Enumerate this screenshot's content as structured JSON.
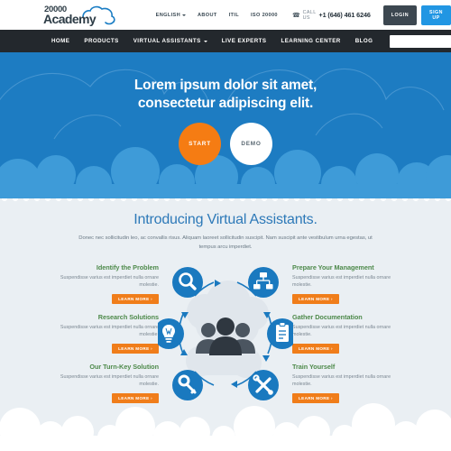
{
  "brand": {
    "logo_top": "20000",
    "logo_bottom": "Academy",
    "cloud_icon": "cloud-icon"
  },
  "topbar": {
    "nav": [
      {
        "label": "ENGLISH",
        "has_caret": true
      },
      {
        "label": "ABOUT",
        "has_caret": false
      },
      {
        "label": "ITIL",
        "has_caret": false
      },
      {
        "label": "ISO 20000",
        "has_caret": false
      }
    ],
    "call_us_label": "CALL US",
    "phone": "+1 (646) 461 6246",
    "login_label": "LOGIN",
    "signup_label": "SIGN UP"
  },
  "mainnav": {
    "items": [
      {
        "label": "HOME",
        "has_caret": false
      },
      {
        "label": "PRODUCTS",
        "has_caret": false
      },
      {
        "label": "VIRTUAL ASSISTANTS",
        "has_caret": true
      },
      {
        "label": "LIVE EXPERTS",
        "has_caret": false
      },
      {
        "label": "LEARNING CENTER",
        "has_caret": false
      },
      {
        "label": "BLOG",
        "has_caret": false
      }
    ],
    "search_placeholder": "",
    "search_value": ""
  },
  "hero": {
    "title_line1": "Lorem ipsum dolor sit amet,",
    "title_line2": "consectetur adipiscing elit.",
    "primary_button": "START",
    "secondary_button": "DEMO",
    "background_color": "#1d7cc2",
    "primary_color": "#f57c13"
  },
  "intro": {
    "title": "Introducing Virtual Assistants.",
    "text": "Donec nec sollicitudin leo, ac convallis risus. Aliquam laoreet sollicitudin suscipit. Nam suscipit ante vestibulum urna egestas, ut tempus arcu imperdiet."
  },
  "features": {
    "learn_more_label": "LEARN MORE ›",
    "accent_color": "#f07d1a",
    "title_color": "#4e8a4b",
    "left": [
      {
        "title": "Identify the Problem",
        "desc": "Suspendisse varius est imperdiet nulla ornare molestie.",
        "icon": "magnifier-icon"
      },
      {
        "title": "Research Solutions",
        "desc": "Suspendisse varius est imperdiet nulla ornare molestie.",
        "icon": "lightbulb-icon"
      },
      {
        "title": "Our Turn-Key Solution",
        "desc": "Suspendisse varius est imperdiet nulla ornare molestie.",
        "icon": "key-icon"
      }
    ],
    "right": [
      {
        "title": "Prepare Your Management",
        "desc": "Suspendisse varius est imperdiet nulla ornare molestie.",
        "icon": "org-chart-icon"
      },
      {
        "title": "Gather Documentation",
        "desc": "Suspendisse varius est imperdiet nulla ornare molestie.",
        "icon": "clipboard-icon"
      },
      {
        "title": "Train Yourself",
        "desc": "Suspendisse varius est imperdiet nulla ornare molestie.",
        "icon": "tools-icon"
      }
    ]
  },
  "diagram": {
    "center_icon": "people-group-icon",
    "circle_color": "#1a79bf",
    "nodes": [
      "magnifier-icon",
      "org-chart-icon",
      "clipboard-icon",
      "tools-icon",
      "key-icon",
      "lightbulb-icon"
    ]
  }
}
